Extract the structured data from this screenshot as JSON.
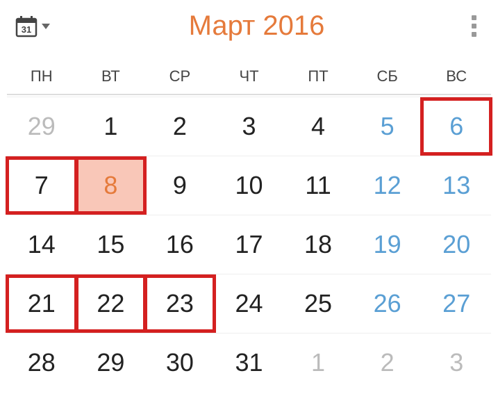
{
  "header": {
    "calendar_icon_day": "31",
    "month_title": "Март 2016"
  },
  "weekdays": [
    "ПН",
    "ВТ",
    "СР",
    "ЧТ",
    "ПТ",
    "СБ",
    "ВС"
  ],
  "days": [
    {
      "n": "29",
      "type": "other",
      "highlight": false,
      "red": false
    },
    {
      "n": "1",
      "type": "regular",
      "highlight": false,
      "red": false
    },
    {
      "n": "2",
      "type": "regular",
      "highlight": false,
      "red": false
    },
    {
      "n": "3",
      "type": "regular",
      "highlight": false,
      "red": false
    },
    {
      "n": "4",
      "type": "regular",
      "highlight": false,
      "red": false
    },
    {
      "n": "5",
      "type": "weekend",
      "highlight": false,
      "red": false
    },
    {
      "n": "6",
      "type": "weekend",
      "highlight": false,
      "red": true
    },
    {
      "n": "7",
      "type": "regular",
      "highlight": false,
      "red": true
    },
    {
      "n": "8",
      "type": "highlight",
      "highlight": true,
      "red": true
    },
    {
      "n": "9",
      "type": "regular",
      "highlight": false,
      "red": false
    },
    {
      "n": "10",
      "type": "regular",
      "highlight": false,
      "red": false
    },
    {
      "n": "11",
      "type": "regular",
      "highlight": false,
      "red": false
    },
    {
      "n": "12",
      "type": "weekend",
      "highlight": false,
      "red": false
    },
    {
      "n": "13",
      "type": "weekend",
      "highlight": false,
      "red": false
    },
    {
      "n": "14",
      "type": "regular",
      "highlight": false,
      "red": false
    },
    {
      "n": "15",
      "type": "regular",
      "highlight": false,
      "red": false
    },
    {
      "n": "16",
      "type": "regular",
      "highlight": false,
      "red": false
    },
    {
      "n": "17",
      "type": "regular",
      "highlight": false,
      "red": false
    },
    {
      "n": "18",
      "type": "regular",
      "highlight": false,
      "red": false
    },
    {
      "n": "19",
      "type": "weekend",
      "highlight": false,
      "red": false
    },
    {
      "n": "20",
      "type": "weekend",
      "highlight": false,
      "red": false
    },
    {
      "n": "21",
      "type": "regular",
      "highlight": false,
      "red": true
    },
    {
      "n": "22",
      "type": "regular",
      "highlight": false,
      "red": true
    },
    {
      "n": "23",
      "type": "regular",
      "highlight": false,
      "red": true
    },
    {
      "n": "24",
      "type": "regular",
      "highlight": false,
      "red": false
    },
    {
      "n": "25",
      "type": "regular",
      "highlight": false,
      "red": false
    },
    {
      "n": "26",
      "type": "weekend",
      "highlight": false,
      "red": false
    },
    {
      "n": "27",
      "type": "weekend",
      "highlight": false,
      "red": false
    },
    {
      "n": "28",
      "type": "regular",
      "highlight": false,
      "red": false
    },
    {
      "n": "29",
      "type": "regular",
      "highlight": false,
      "red": false
    },
    {
      "n": "30",
      "type": "regular",
      "highlight": false,
      "red": false
    },
    {
      "n": "31",
      "type": "regular",
      "highlight": false,
      "red": false
    },
    {
      "n": "1",
      "type": "other",
      "highlight": false,
      "red": false
    },
    {
      "n": "2",
      "type": "other",
      "highlight": false,
      "red": false
    },
    {
      "n": "3",
      "type": "other",
      "highlight": false,
      "red": false
    }
  ]
}
